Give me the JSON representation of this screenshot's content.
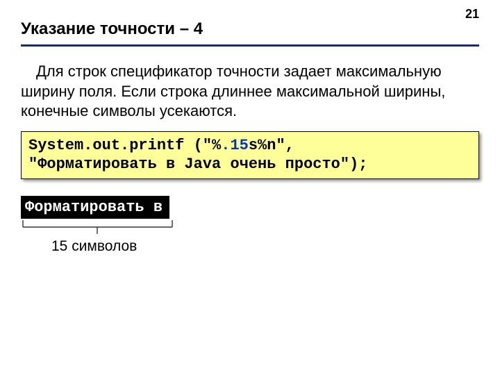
{
  "page_number": "21",
  "title": "Указание точности – 4",
  "body_text": "Для строк спецификатор точности задает максимальную ширину поля. Если строка длиннее максимальной ширины, конечные символы усекаются.",
  "code": {
    "part1": "System.out.printf (\"%",
    "precision": ".15",
    "part2": "s%n\",",
    "line2": "\"Форматировать в Java очень просто\");"
  },
  "output": "Форматировать в",
  "caption": "15 символов"
}
